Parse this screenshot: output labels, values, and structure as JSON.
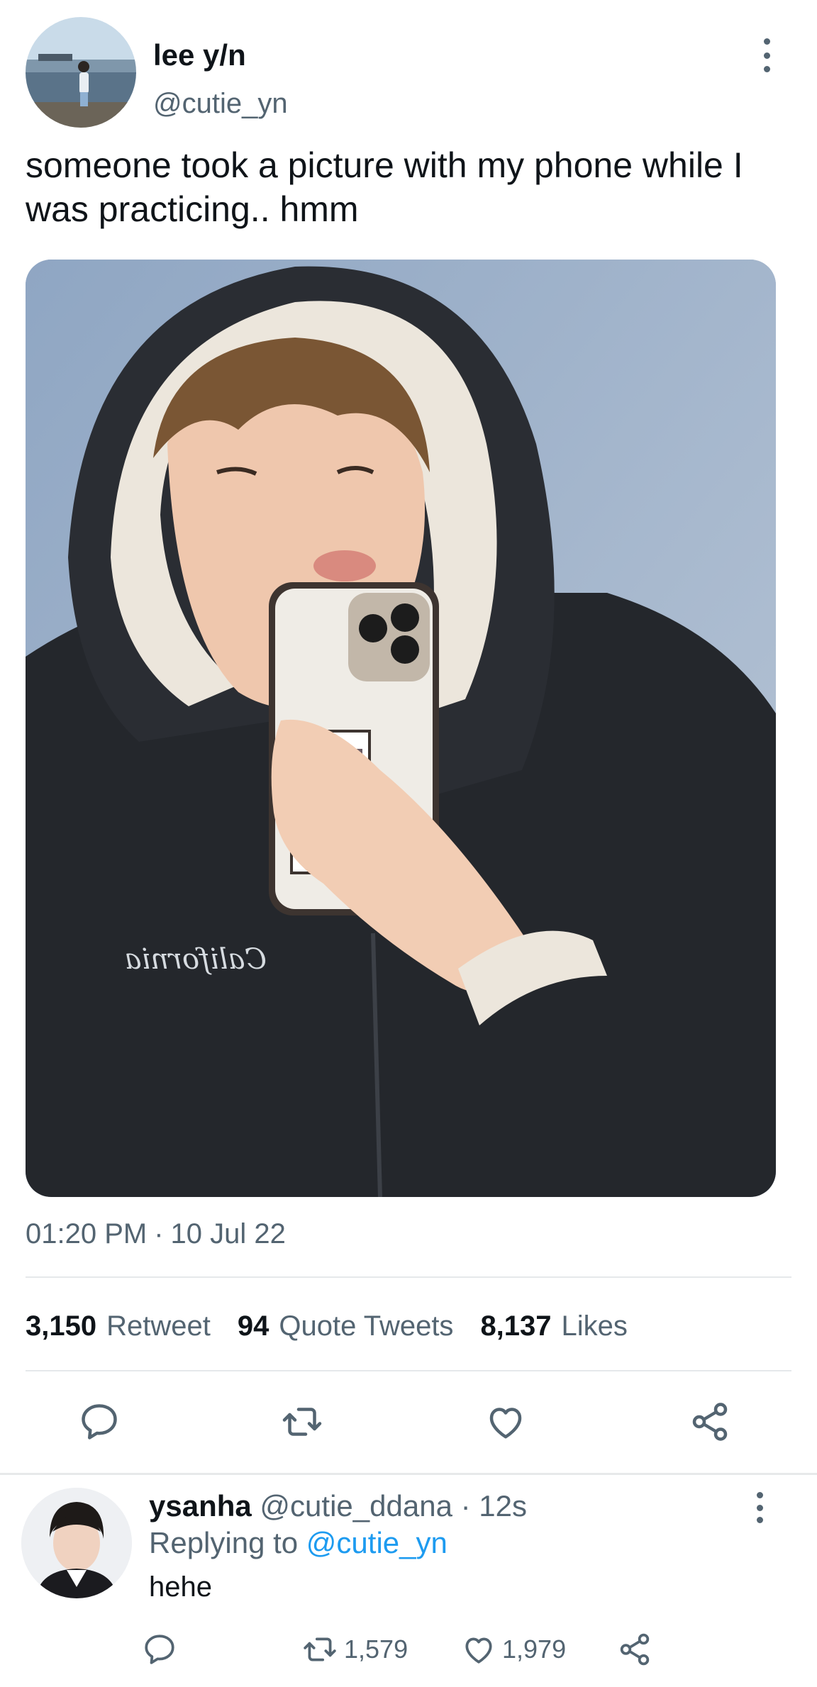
{
  "tweet": {
    "author_name": "lee y/n",
    "author_handle": "@cutie_yn",
    "text": "someone took a picture with my phone while I was practicing.. hmm",
    "time": "01:20 PM",
    "separator": "·",
    "date": "10 Jul 22",
    "stats": {
      "retweets_count": "3,150",
      "retweets_label": "Retweet",
      "quotes_count": "94",
      "quotes_label": "Quote Tweets",
      "likes_count": "8,137",
      "likes_label": "Likes"
    },
    "photo_print": "California"
  },
  "reply": {
    "name": "ysanha",
    "handle": "@cutie_ddana",
    "age": "· 12s",
    "replying_prefix": "Replying to",
    "replying_to": "@cutie_yn",
    "text": "hehe",
    "retweets": "1,579",
    "likes": "1,979"
  },
  "icons": [
    "more-vertical-icon",
    "reply-icon",
    "retweet-icon",
    "like-icon",
    "share-icon"
  ],
  "colors": {
    "text": "#0f1419",
    "secondary": "#536471",
    "link": "#1d9bf0",
    "divider": "#e5e8eb"
  }
}
